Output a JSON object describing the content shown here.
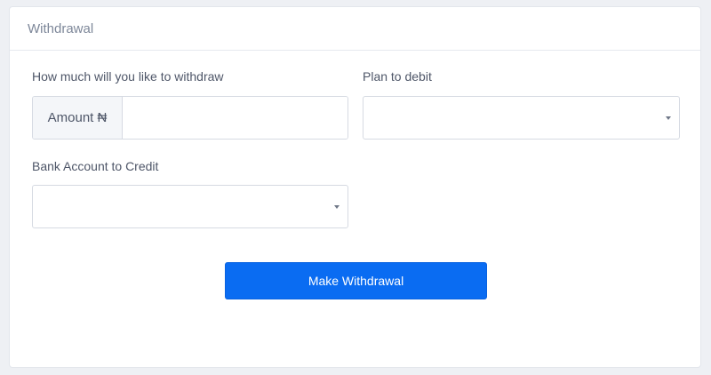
{
  "card": {
    "title": "Withdrawal"
  },
  "amount": {
    "label": "How much will you like to withdraw",
    "addon": "Amount ₦",
    "value": "",
    "placeholder": ""
  },
  "plan": {
    "label": "Plan to debit",
    "selected": "",
    "icon": "chevron-down-icon"
  },
  "bank": {
    "label": "Bank Account to Credit",
    "selected": "",
    "icon": "chevron-down-icon"
  },
  "actions": {
    "submit_label": "Make Withdrawal"
  },
  "colors": {
    "primary_button": "#0a6cf2",
    "background": "#eef0f4",
    "card": "#ffffff"
  }
}
